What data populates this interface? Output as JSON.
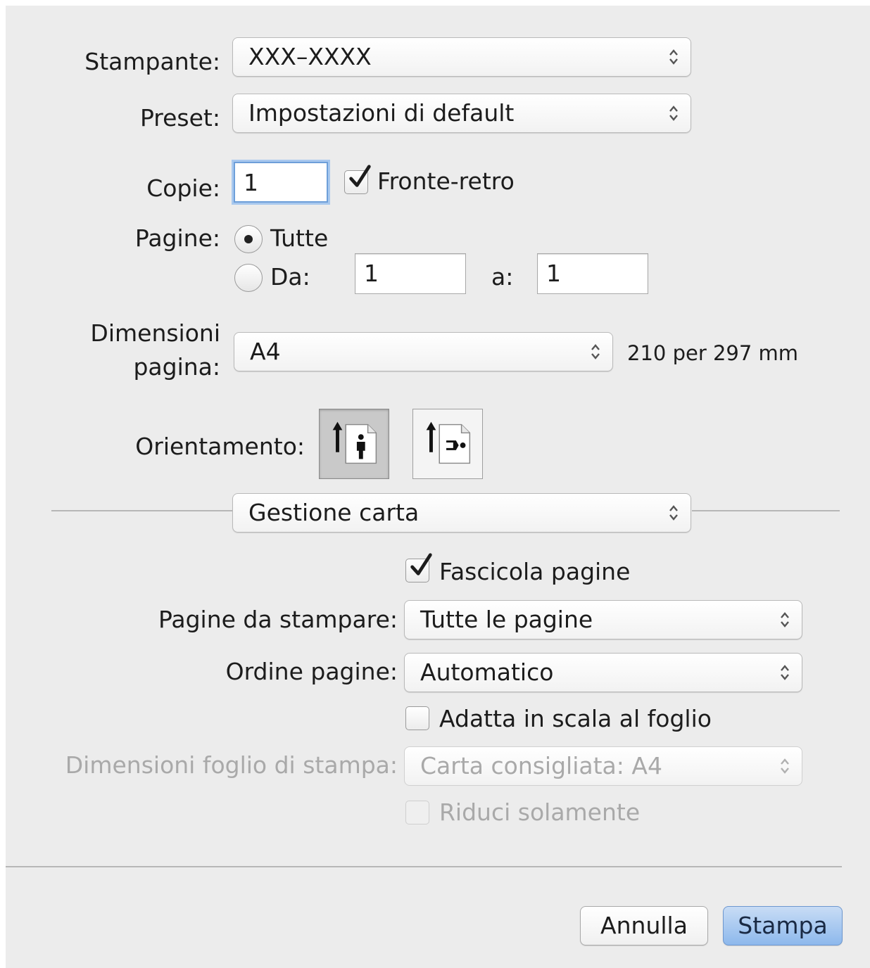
{
  "printer": {
    "label": "Stampante:",
    "value": "XXX–XXXX"
  },
  "preset": {
    "label": "Preset:",
    "value": "Impostazioni di default"
  },
  "copies": {
    "label": "Copie:",
    "value": "1",
    "duplex_label": "Fronte-retro",
    "duplex_checked": true
  },
  "pages": {
    "label": "Pagine:",
    "all_label": "Tutte",
    "from_label": "Da:",
    "from_value": "1",
    "to_label": "a:",
    "to_value": "1",
    "selected": "all"
  },
  "paper_size": {
    "label_line1": "Dimensioni",
    "label_line2": "pagina:",
    "value": "A4",
    "dimensions": "210 per 297 mm"
  },
  "orientation": {
    "label": "Orientamento:",
    "options": [
      "portrait",
      "landscape"
    ],
    "selected": "portrait"
  },
  "section_popup": {
    "value": "Gestione carta"
  },
  "paper_handling": {
    "collate_label": "Fascicola pagine",
    "collate_checked": true,
    "pages_to_print_label": "Pagine da stampare:",
    "pages_to_print_value": "Tutte le pagine",
    "page_order_label": "Ordine pagine:",
    "page_order_value": "Automatico",
    "scale_to_fit_label": "Adatta in scala al foglio",
    "scale_to_fit_checked": false,
    "dest_paper_label": "Dimensioni foglio di stampa:",
    "dest_paper_value": "Carta consigliata: A4",
    "scale_down_only_label": "Riduci solamente",
    "scale_down_only_checked": false
  },
  "footer": {
    "cancel_label": "Annulla",
    "print_label": "Stampa"
  },
  "colors": {
    "accent": "#6e9fd9",
    "primary_button": "#8db8ec",
    "background": "#ececec"
  },
  "icons": {
    "popup_arrows": "up-down-chevron-icon",
    "checkmark": "checkmark-icon",
    "portrait": "portrait-orientation-icon",
    "landscape": "landscape-orientation-icon"
  }
}
